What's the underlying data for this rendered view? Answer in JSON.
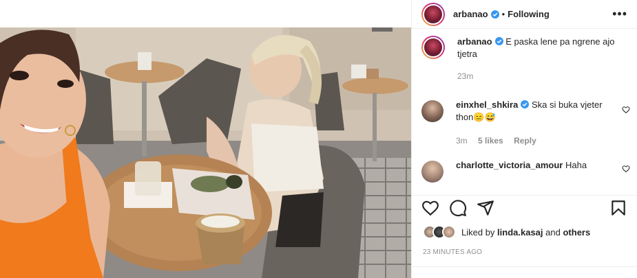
{
  "post": {
    "username": "arbanao",
    "separator": "•",
    "follow_status": "Following",
    "more_label": "•••"
  },
  "caption": {
    "username": "arbanao",
    "text": "E paska lene pa ngrene ajo tjetra",
    "time": "23m"
  },
  "comments": [
    {
      "username": "einxhel_shkira",
      "text": "Ska si buka vjeter thon😑😅",
      "time": "3m",
      "likes": "5 likes",
      "reply": "Reply"
    },
    {
      "username": "charlotte_victoria_amour",
      "text": "Haha"
    }
  ],
  "likes": {
    "prefix": "Liked by",
    "user": "linda.kasaj",
    "conj": "and",
    "others": "others"
  },
  "timestamp": "23 MINUTES AGO",
  "icons": [
    "verified-icon",
    "more-icon",
    "heart-icon",
    "comment-icon",
    "share-icon",
    "save-icon"
  ],
  "colors": {
    "verified": "#3897f0",
    "muted": "#8e8e8e",
    "text": "#262626"
  }
}
